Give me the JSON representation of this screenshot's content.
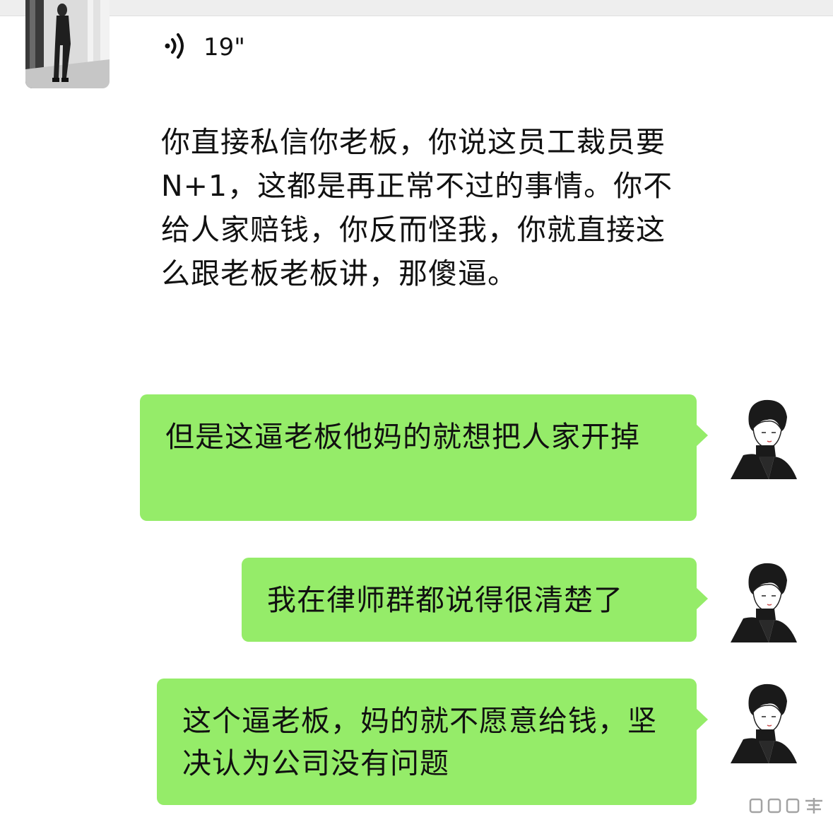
{
  "incoming": {
    "voice_duration": "19\"",
    "transcript": "你直接私信你老板，你说这员工裁员要N+1，这都是再正常不过的事情。你不给人家赔钱，你反而怪我，你就直接这么跟老板老板讲，那傻逼。"
  },
  "outgoing": [
    {
      "text": "但是这逼老板他妈的就想把人家开掉"
    },
    {
      "text": "我在律师群都说得很清楚了"
    },
    {
      "text": "这个逼老板，妈的就不愿意给钱，坚决认为公司没有问题"
    }
  ],
  "colors": {
    "bubble": "#95ec69",
    "background": "#ffffff",
    "text": "#111111"
  },
  "icons": {
    "voice": "voice-wave-icon"
  }
}
